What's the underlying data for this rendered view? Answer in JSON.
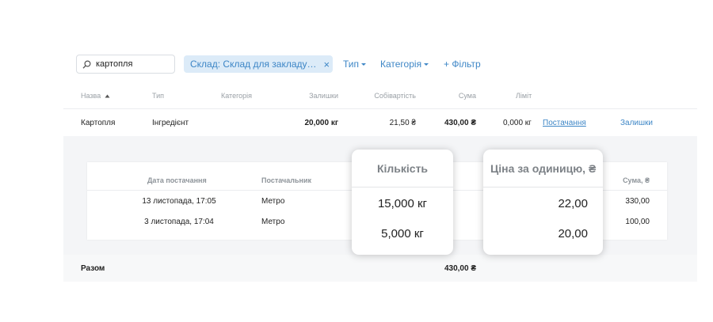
{
  "toolbar": {
    "search_value": "картопля",
    "filter_chip_label": "Склад: Склад для закладу…",
    "filter_chip_close": "×",
    "type_filter": "Тип",
    "category_filter": "Категорія",
    "add_filter": "+ Фільтр"
  },
  "table": {
    "headers": {
      "name": "Назва",
      "type": "Тип",
      "category": "Категорія",
      "stock": "Залишки",
      "cost": "Собівартість",
      "sum": "Сума",
      "limit": "Ліміт"
    },
    "row": {
      "name": "Картопля",
      "type": "Інгредієнт",
      "category": "",
      "stock": "20,000 кг",
      "cost": "21,50 ₴",
      "sum": "430,00 ₴",
      "limit": "0,000 кг",
      "supplies_link": "Постачання",
      "stock_link": "Залишки"
    },
    "total": {
      "label": "Разом",
      "sum": "430,00 ₴"
    }
  },
  "supplies": {
    "headers": {
      "date": "Дата постачання",
      "supplier": "Постачальник",
      "quantity": "Кількість",
      "unit_price": "Ціна за одиницю, ₴",
      "sum": "Сума, ₴"
    },
    "rows": [
      {
        "date": "13 листопада, 17:05",
        "supplier": "Метро",
        "quantity": "15,000 кг",
        "unit_price": "22,00",
        "sum": "330,00"
      },
      {
        "date": "3 листопада, 17:04",
        "supplier": "Метро",
        "quantity": "5,000 кг",
        "unit_price": "20,00",
        "sum": "100,00"
      }
    ]
  }
}
